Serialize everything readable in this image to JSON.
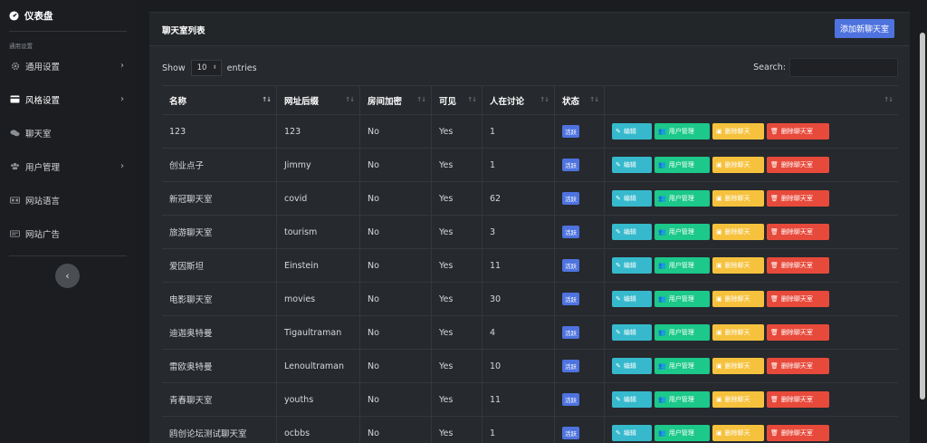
{
  "sidebar": {
    "brand": "仪表盘",
    "section_title": "通用设置",
    "items": [
      {
        "label": "通用设置",
        "icon": "gear-icon",
        "has_submenu": true
      },
      {
        "label": "风格设置",
        "icon": "card-icon",
        "has_submenu": true
      },
      {
        "label": "聊天室",
        "icon": "chat-icon",
        "has_submenu": false
      },
      {
        "label": "用户管理",
        "icon": "users-icon",
        "has_submenu": true
      },
      {
        "label": "网站语言",
        "icon": "language-icon",
        "has_submenu": false
      },
      {
        "label": "网站广告",
        "icon": "ad-icon",
        "has_submenu": false
      }
    ]
  },
  "card": {
    "title": "聊天室列表",
    "add_button": "添加新聊天室"
  },
  "table_controls": {
    "show_label": "Show",
    "length_value": "10",
    "entries_label": "entries",
    "search_label": "Search:"
  },
  "table": {
    "headers": [
      "名称",
      "网址后缀",
      "房间加密",
      "可见",
      "人在讨论",
      "状态",
      ""
    ],
    "rows": [
      {
        "name": "123",
        "slug": "123",
        "encrypted": "No",
        "visible": "Yes",
        "online": "1",
        "status": "活跃"
      },
      {
        "name": "创业点子",
        "slug": "Jimmy",
        "encrypted": "No",
        "visible": "Yes",
        "online": "1",
        "status": "活跃"
      },
      {
        "name": "新冠聊天室",
        "slug": "covid",
        "encrypted": "No",
        "visible": "Yes",
        "online": "62",
        "status": "活跃"
      },
      {
        "name": "旅游聊天室",
        "slug": "tourism",
        "encrypted": "No",
        "visible": "Yes",
        "online": "3",
        "status": "活跃"
      },
      {
        "name": "爱因斯坦",
        "slug": "Einstein",
        "encrypted": "No",
        "visible": "Yes",
        "online": "11",
        "status": "活跃"
      },
      {
        "name": "电影聊天室",
        "slug": "movies",
        "encrypted": "No",
        "visible": "Yes",
        "online": "30",
        "status": "活跃"
      },
      {
        "name": "迪迦奥特曼",
        "slug": "Tigaultraman",
        "encrypted": "No",
        "visible": "Yes",
        "online": "4",
        "status": "活跃"
      },
      {
        "name": "雷欧奥特曼",
        "slug": "Lenoultraman",
        "encrypted": "No",
        "visible": "Yes",
        "online": "10",
        "status": "活跃"
      },
      {
        "name": "青春聊天室",
        "slug": "youths",
        "encrypted": "No",
        "visible": "Yes",
        "online": "11",
        "status": "活跃"
      },
      {
        "name": "鸥创论坛测试聊天室",
        "slug": "ocbbs",
        "encrypted": "No",
        "visible": "Yes",
        "online": "1",
        "status": "活跃"
      }
    ],
    "actions": {
      "edit": "编辑",
      "users": "用户管理",
      "delete_chat": "删除聊天",
      "delete_room": "删除聊天室"
    }
  },
  "colors": {
    "primary": "#4e73df",
    "info": "#36b9cc",
    "success": "#1cc88a",
    "warning": "#f6c23e",
    "danger": "#e74a3b"
  }
}
